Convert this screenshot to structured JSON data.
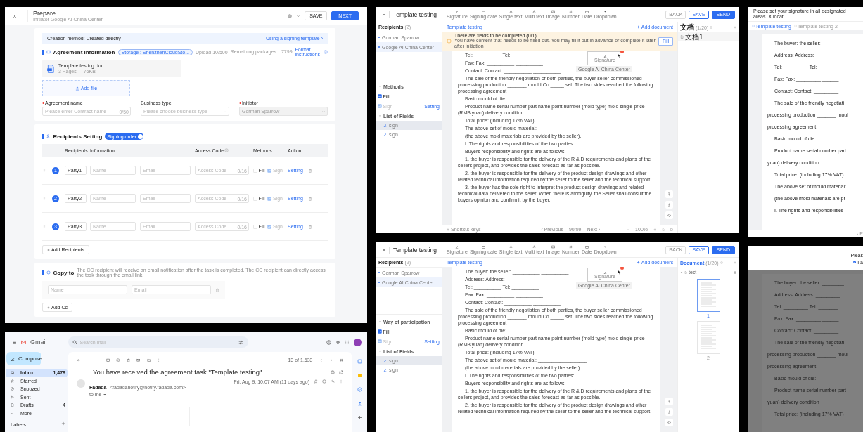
{
  "prepare": {
    "title": "Prepare",
    "subtitle": "Initiator Google AI China Center",
    "buttons": [
      {
        "label": "SAVE",
        "primary": false
      },
      {
        "label": "NEXT",
        "primary": true
      }
    ],
    "banner": {
      "text": "Creation method: Created directly",
      "link": "Using a signing template ›"
    },
    "agreement": {
      "heading": "Agreement information",
      "storage": "Storage : ShenzhenCloudSto...",
      "upload": "Upload 10/500",
      "remaining": "Remaining packages：7799",
      "format_link": "Format instructions",
      "file": {
        "name": "Template testing.doc",
        "pages": "3 Pages",
        "size": "76KB"
      },
      "add_file": "Add file",
      "fields": [
        {
          "label": "Agreement name",
          "required": true,
          "placeholder": "Please enter Contract name",
          "counter": "0/50",
          "kind": "text",
          "disabled": false
        },
        {
          "label": "Business type",
          "required": false,
          "placeholder": "Please choose business type",
          "kind": "select",
          "disabled": false
        },
        {
          "label": "Initiator",
          "required": true,
          "value": "Gorman Sparrow",
          "kind": "select",
          "disabled": true
        }
      ]
    },
    "recipients": {
      "heading": "Recipients Setting",
      "toggle": {
        "label": "Signing order",
        "on": true
      },
      "columns": [
        "Recipients",
        "Information",
        "Access Code",
        "Methods",
        "Action"
      ],
      "rows": [
        {
          "index": "1",
          "party": "Party1",
          "name_placeholder": "Name",
          "email_placeholder": "Email",
          "code_placeholder": "Access Code",
          "counter": "0/16",
          "fill": {
            "label": "Fill",
            "checked": false
          },
          "sign": {
            "label": "Sign",
            "checked": true
          },
          "action": "Setting"
        },
        {
          "index": "2",
          "party": "Party2",
          "name_placeholder": "Name",
          "email_placeholder": "Email",
          "code_placeholder": "Access Code",
          "counter": "0/16",
          "fill": {
            "label": "Fill",
            "checked": false
          },
          "sign": {
            "label": "Sign",
            "checked": true
          },
          "action": "Setting"
        },
        {
          "index": "3",
          "party": "Party3",
          "name_placeholder": "Name",
          "email_placeholder": "Email",
          "code_placeholder": "Access Code",
          "counter": "0/16",
          "fill": {
            "label": "Fill",
            "checked": false
          },
          "sign": {
            "label": "Sign",
            "checked": true
          },
          "action": "Setting"
        }
      ],
      "add": "Add Recipients"
    },
    "copy_to": {
      "heading": "Copy to",
      "note": "The CC recipient will receive an email notification after the task is completed. The CC recipient can directly access the task through the email link.",
      "name_placeholder": "Name",
      "email_placeholder": "Email",
      "add": "Add Cc"
    }
  },
  "gmail": {
    "brand": "Gmail",
    "search_placeholder": "Search mail",
    "compose": "Compose",
    "nav": [
      {
        "label": "Inbox",
        "count": "1,478",
        "selected": true
      },
      {
        "label": "Starred",
        "selected": false
      },
      {
        "label": "Snoozed",
        "selected": false
      },
      {
        "label": "Sent",
        "selected": false
      },
      {
        "label": "Drafts",
        "count": "4",
        "selected": false
      },
      {
        "label": "More",
        "selected": false
      }
    ],
    "labels_heading": "Labels",
    "pager": "13 of 1,633",
    "subject": "You have received the agreement task \"Template testing\"",
    "sender": "Fadada",
    "sender_email": "<fadadanotify@notify.fadada.com>",
    "date": "Fri, Aug 9, 10:07 AM (11 days ago)",
    "to": "to me"
  },
  "editors": [
    {
      "title": "Template testing",
      "tools": [
        "Signature",
        "Signing date",
        "Single text",
        "Multi text",
        "Image",
        "Number",
        "Date",
        "Dropdown"
      ],
      "buttons": [
        {
          "label": "BACK",
          "kind": "plain"
        },
        {
          "label": "SAVE",
          "kind": "outline"
        },
        {
          "label": "SEND",
          "kind": "primary"
        }
      ],
      "recipients_heading": "Recipients",
      "recipients_count": "(2)",
      "recipients": [
        {
          "name": "Gorman Sparrow",
          "selected": false
        },
        {
          "name": "Google AI China Center",
          "selected": true
        }
      ],
      "methods_heading": "Methods",
      "methods": [
        {
          "label": "Fill",
          "checked": true,
          "disabled": false
        },
        {
          "label": "Sign",
          "checked": true,
          "disabled": true,
          "link": "Setting"
        }
      ],
      "fields_heading": "List of Fields",
      "fields": [
        {
          "label": "sign",
          "selected": true
        },
        {
          "label": "sign",
          "selected": false
        }
      ],
      "breadcrumb": "Template testing",
      "add_document": "Add document",
      "warning": {
        "title": "There are fields to be completed",
        "count": "(0/1)",
        "text": "You have content that needs to be filled out. You may fill it out in advance or complete it later after initiation",
        "button": "Fill"
      },
      "doc": [
        "Tel: __________ Tel: __________",
        "Fax: Fax: __________ __________",
        "Contact: Contact: __________ __________",
        "The sale of the friendly negotiation of both parties, the buyer seller commissioned processing production _______ mould Co _____ set. The two sides reached the following processing agreement",
        "Basic mould of die:",
        "Product name serial number part name point number (mold type) mold single price (RMB yuan) delivery condition",
        "Total price: (including 17% VAT)",
        "The above set of mould material: __________________",
        "(the above mold materials are provided by the seller).",
        "I. The rights and responsibilities of the two parties:",
        "Buyers responsibility and rights are as follows:",
        "1. the buyer is responsible for the delivery of the R & D requirements and plans of the sellers project, and provides the sales forecast as far as possible.",
        "2. the buyer is responsible for the delivery of the product design drawings and other related technical information required by the seller to the seller and the technical support.",
        "3. the buyer has the sole right to interpret the product design drawings and related technical data delivered to the seller. When there is ambiguity, the Seller shall consult the buyers opinion and confirm it by the buyer."
      ],
      "signature_field": {
        "label": "Signature",
        "owner": "Google AI China Center"
      },
      "footer": {
        "shortcut": "Shortcut keys",
        "prev": "‹ Previous",
        "page": "90/99",
        "next": "Next ›",
        "zoom": "100%"
      },
      "documents_heading": "文档",
      "documents_count": "(1/20)",
      "documents": [
        {
          "name": "文档1",
          "kind": "file"
        }
      ]
    },
    {
      "title": "Template testing",
      "tools": [
        "Signature",
        "Signing date",
        "Single text",
        "Multi text",
        "Image",
        "Number",
        "Date",
        "Dropdown"
      ],
      "buttons": [
        {
          "label": "BACK",
          "kind": "plain"
        },
        {
          "label": "SAVE",
          "kind": "outline"
        },
        {
          "label": "SEND",
          "kind": "primary"
        }
      ],
      "recipients_heading": "Recipients",
      "recipients_count": "(2)",
      "recipients": [
        {
          "name": "Gorman Sparrow",
          "selected": false
        },
        {
          "name": "Google AI China Center",
          "selected": true
        }
      ],
      "methods_heading": "Way of participation",
      "methods": [
        {
          "label": "Fill",
          "checked": true,
          "disabled": false
        },
        {
          "label": "Sign",
          "checked": true,
          "disabled": true,
          "link": "Setting"
        }
      ],
      "fields_heading": "List of Fields",
      "fields": [
        {
          "label": "sign",
          "selected": true
        },
        {
          "label": "sign",
          "selected": false
        }
      ],
      "breadcrumb": "Template testing",
      "add_document": "Add document",
      "doc": [
        "The buyer: the seller: __________ __________",
        "Address: Address: __________ __________",
        "Tel: __________ Tel: __________",
        "Fax: Fax: __________ __________",
        "Contact: Contact: __________ __________",
        "The sale of the friendly negotiation of both parties, the buyer seller commissioned processing production _______ mould Co _____ set. The two sides reached the following processing agreement",
        "Basic mould of die:",
        "Product name serial number part name point number (mold type) mold single price (RMB yuan) delivery condition",
        "Total price: (including 17% VAT)",
        "The above set of mould material: __________________",
        "(the above mold materials are provided by the seller).",
        "I. The rights and responsibilities of the two parties:",
        "Buyers responsibility and rights are as follows:",
        "1. the buyer is responsible for the delivery of the R & D requirements and plans of the sellers project, and provides the sales forecast as far as possible.",
        "2. the buyer is responsible for the delivery of the product design drawings and other related technical information required by the seller to the seller and the technical support."
      ],
      "signature_field": {
        "label": "Signature",
        "owner": "Google AI China Center"
      },
      "documents_heading": "Document",
      "documents_count": "(1/20)",
      "documents": [
        {
          "name": "test",
          "kind": "folder",
          "pages": [
            "1",
            "2"
          ]
        }
      ]
    }
  ],
  "previews": [
    {
      "notice": "Please set your signature in all designated areas. X locati",
      "tabs": [
        {
          "label": "Template testing",
          "selected": true
        },
        {
          "label": "Template testing 2",
          "selected": false
        }
      ],
      "dimmed": false,
      "pager": "‹ P",
      "lines": [
        {
          "text": "The buyer: the seller: ________",
          "indent": true
        },
        {
          "text": "Address: Address: _________",
          "indent": true
        },
        {
          "text": "Tel: _________ Tel: _______",
          "indent": true
        },
        {
          "text": "Fax: Fax: _________ ______",
          "indent": true
        },
        {
          "text": "Contact: Contact: _________",
          "indent": true
        },
        {
          "text": "The sale of the friendly negotiati",
          "indent": true
        },
        {
          "text": "processing production _______ moul",
          "indent": false
        },
        {
          "text": "processing agreement",
          "indent": false
        },
        {
          "text": "Basic mould of die:",
          "indent": true
        },
        {
          "text": "Product name serial number part",
          "indent": true
        },
        {
          "text": "yuan) delivery condition",
          "indent": false
        },
        {
          "text": "Total price: (including 17% VAT)",
          "indent": true
        },
        {
          "text": "The above set of mould material:",
          "indent": true
        },
        {
          "text": "(the above mold materials are pr",
          "indent": true
        },
        {
          "text": "I. The rights and responsibilities",
          "indent": true
        }
      ]
    },
    {
      "notice": "Pleas",
      "agree": {
        "label": "I a",
        "checked": true
      },
      "dimmed": true,
      "lines": [
        {
          "text": "The buyer: the seller: ________",
          "indent": true
        },
        {
          "text": "Address: Address: _________",
          "indent": true
        },
        {
          "text": "Tel: _________ Tel: _______",
          "indent": true
        },
        {
          "text": "Fax: Fax: _________ ______",
          "indent": true
        },
        {
          "text": "Contact: Contact: _________",
          "indent": true
        },
        {
          "text": "The sale of the friendly negotiati",
          "indent": true
        },
        {
          "text": "processing production _______ moul",
          "indent": false
        },
        {
          "text": "processing agreement",
          "indent": false
        },
        {
          "text": "Basic mould of die:",
          "indent": true
        },
        {
          "text": "Product name serial number part",
          "indent": true
        },
        {
          "text": "yuan) delivery condition",
          "indent": false
        },
        {
          "text": "Total price: (including 17% VAT)",
          "indent": true
        }
      ]
    }
  ]
}
